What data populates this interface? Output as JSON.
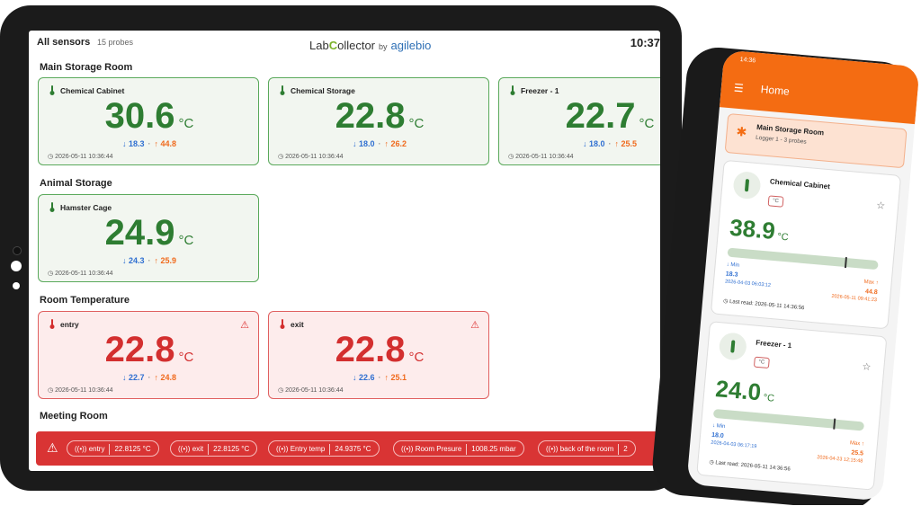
{
  "tablet": {
    "title": "All sensors",
    "probe_count": "15 probes",
    "clock": "10:37",
    "logo": {
      "lab": "Lab",
      "c": "C",
      "ollector": "ollector",
      "by": "by",
      "agile": "agilebio"
    },
    "sections": [
      {
        "name": "Main Storage Room"
      },
      {
        "name": "Animal Storage"
      },
      {
        "name": "Room Temperature"
      },
      {
        "name": "Meeting Room"
      }
    ],
    "cards": [
      {
        "name": "Chemical Cabinet",
        "value": "30.6",
        "unit": "°C",
        "min": "18.3",
        "max": "44.8",
        "time": "2026-05-11 10:36:44",
        "status": "ok"
      },
      {
        "name": "Chemical Storage",
        "value": "22.8",
        "unit": "°C",
        "min": "18.0",
        "max": "26.2",
        "time": "2026-05-11 10:36:44",
        "status": "ok"
      },
      {
        "name": "Freezer - 1",
        "value": "22.7",
        "unit": "°C",
        "min": "18.0",
        "max": "25.5",
        "time": "2026-05-11 10:36:44",
        "status": "ok"
      },
      {
        "name": "Hamster Cage",
        "value": "24.9",
        "unit": "°C",
        "min": "24.3",
        "max": "25.9",
        "time": "2026-05-11 10:36:44",
        "status": "ok"
      },
      {
        "name": "entry",
        "value": "22.8",
        "unit": "°C",
        "min": "22.7",
        "max": "24.8",
        "time": "2026-05-11 10:36:44",
        "status": "alarm"
      },
      {
        "name": "exit",
        "value": "22.8",
        "unit": "°C",
        "min": "22.6",
        "max": "25.1",
        "time": "2026-05-11 10:36:44",
        "status": "alarm"
      }
    ],
    "alarm_chips": [
      {
        "label": "entry",
        "value": "22.8125 °C"
      },
      {
        "label": "exit",
        "value": "22.8125 °C"
      },
      {
        "label": "Entry temp",
        "value": "24.9375 °C"
      },
      {
        "label": "Room Presure",
        "value": "1008.25 mbar"
      },
      {
        "label": "back of the room",
        "value": "2"
      }
    ]
  },
  "phone": {
    "status_time": "14:36",
    "header_title": "Home",
    "room_name": "Main Storage Room",
    "room_sub": "Logger 1 - 3 probes",
    "cards": [
      {
        "name": "Chemical Cabinet",
        "unit_badge": "°C",
        "value": "38.9",
        "unit": "°C",
        "min_label": "Min",
        "min": "18.3",
        "min_date": "2026-04-03 06:03:12",
        "max_label": "Max",
        "max": "44.8",
        "max_date": "2026-05-11 09:41:23",
        "last_read": "Last read: 2026-05-11 14:36:56",
        "range_position": 0.78
      },
      {
        "name": "Freezer - 1",
        "unit_badge": "°C",
        "value": "24.0",
        "unit": "°C",
        "min_label": "Min",
        "min": "18.0",
        "min_date": "2026-04-03 06:17:19",
        "max_label": "Max",
        "max": "25.5",
        "max_date": "2026-04-23 12:15:48",
        "last_read": "Last read: 2026-05-11 14:36:56",
        "range_position": 0.8
      }
    ]
  },
  "colors": {
    "ok": "#2e7d32",
    "alarm": "#d32f2f",
    "brand_orange": "#f46c12",
    "min": "#2f6fd1",
    "max": "#f06a1d"
  }
}
